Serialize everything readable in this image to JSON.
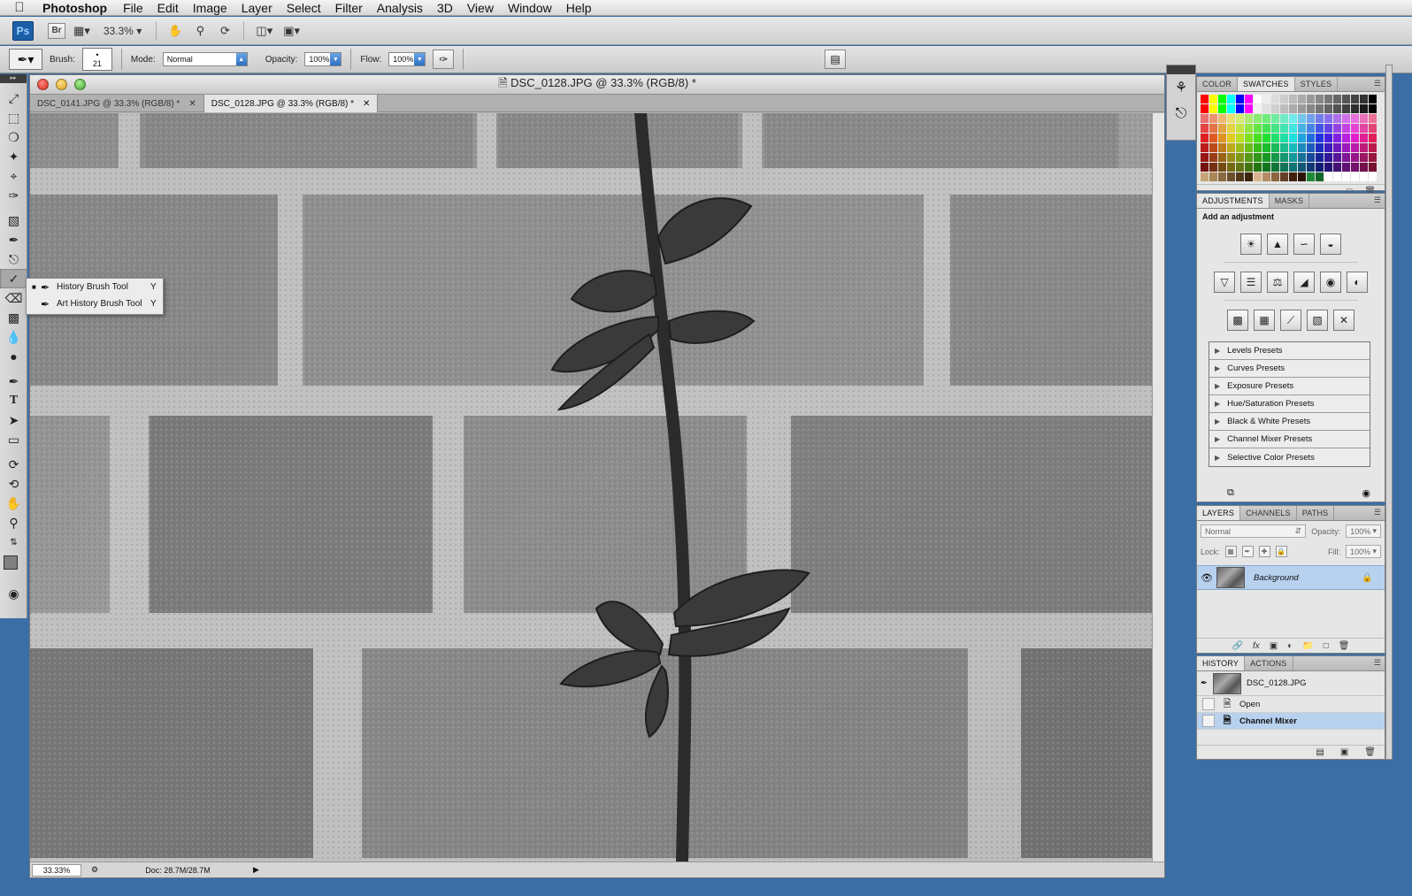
{
  "menubar": {
    "app_name": "Photoshop",
    "items": [
      "File",
      "Edit",
      "Image",
      "Layer",
      "Select",
      "Filter",
      "Analysis",
      "3D",
      "View",
      "Window",
      "Help"
    ]
  },
  "appbar": {
    "ps_label": "Ps",
    "br_label": "Br",
    "zoom": "33.3%"
  },
  "options": {
    "brush_label": "Brush:",
    "brush_size": "21",
    "mode_label": "Mode:",
    "mode_value": "Normal",
    "opacity_label": "Opacity:",
    "opacity_value": "100%",
    "flow_label": "Flow:",
    "flow_value": "100%"
  },
  "flyout": {
    "items": [
      {
        "label": "History Brush Tool",
        "key": "Y",
        "selected": true
      },
      {
        "label": "Art History Brush Tool",
        "key": "Y",
        "selected": false
      }
    ]
  },
  "document": {
    "title": "DSC_0128.JPG @ 33.3% (RGB/8) *",
    "tabs": [
      {
        "label": "DSC_0141.JPG @ 33.3% (RGB/8) *"
      },
      {
        "label": "DSC_0128.JPG @ 33.3% (RGB/8) *"
      }
    ],
    "status_zoom": "33.33%",
    "status_doc": "Doc: 28.7M/28.7M"
  },
  "swatches_panel": {
    "tabs": [
      "COLOR",
      "SWATCHES",
      "STYLES"
    ]
  },
  "adjustments_panel": {
    "tabs": [
      "ADJUSTMENTS",
      "MASKS"
    ],
    "title": "Add an adjustment",
    "presets": [
      "Levels Presets",
      "Curves Presets",
      "Exposure Presets",
      "Hue/Saturation Presets",
      "Black & White Presets",
      "Channel Mixer Presets",
      "Selective Color Presets"
    ]
  },
  "layers_panel": {
    "tabs": [
      "LAYERS",
      "CHANNELS",
      "PATHS"
    ],
    "blend_mode": "Normal",
    "opacity_label": "Opacity:",
    "opacity_value": "100%",
    "lock_label": "Lock:",
    "fill_label": "Fill:",
    "fill_value": "100%",
    "layer_name": "Background"
  },
  "history_panel": {
    "tabs": [
      "HISTORY",
      "ACTIONS"
    ],
    "snapshot": "DSC_0128.JPG",
    "states": [
      {
        "label": "Open",
        "active": false
      },
      {
        "label": "Channel Mixer",
        "active": true
      }
    ]
  },
  "colors": {
    "accent": "#3a6ea5",
    "selection": "#b7d1ef"
  }
}
